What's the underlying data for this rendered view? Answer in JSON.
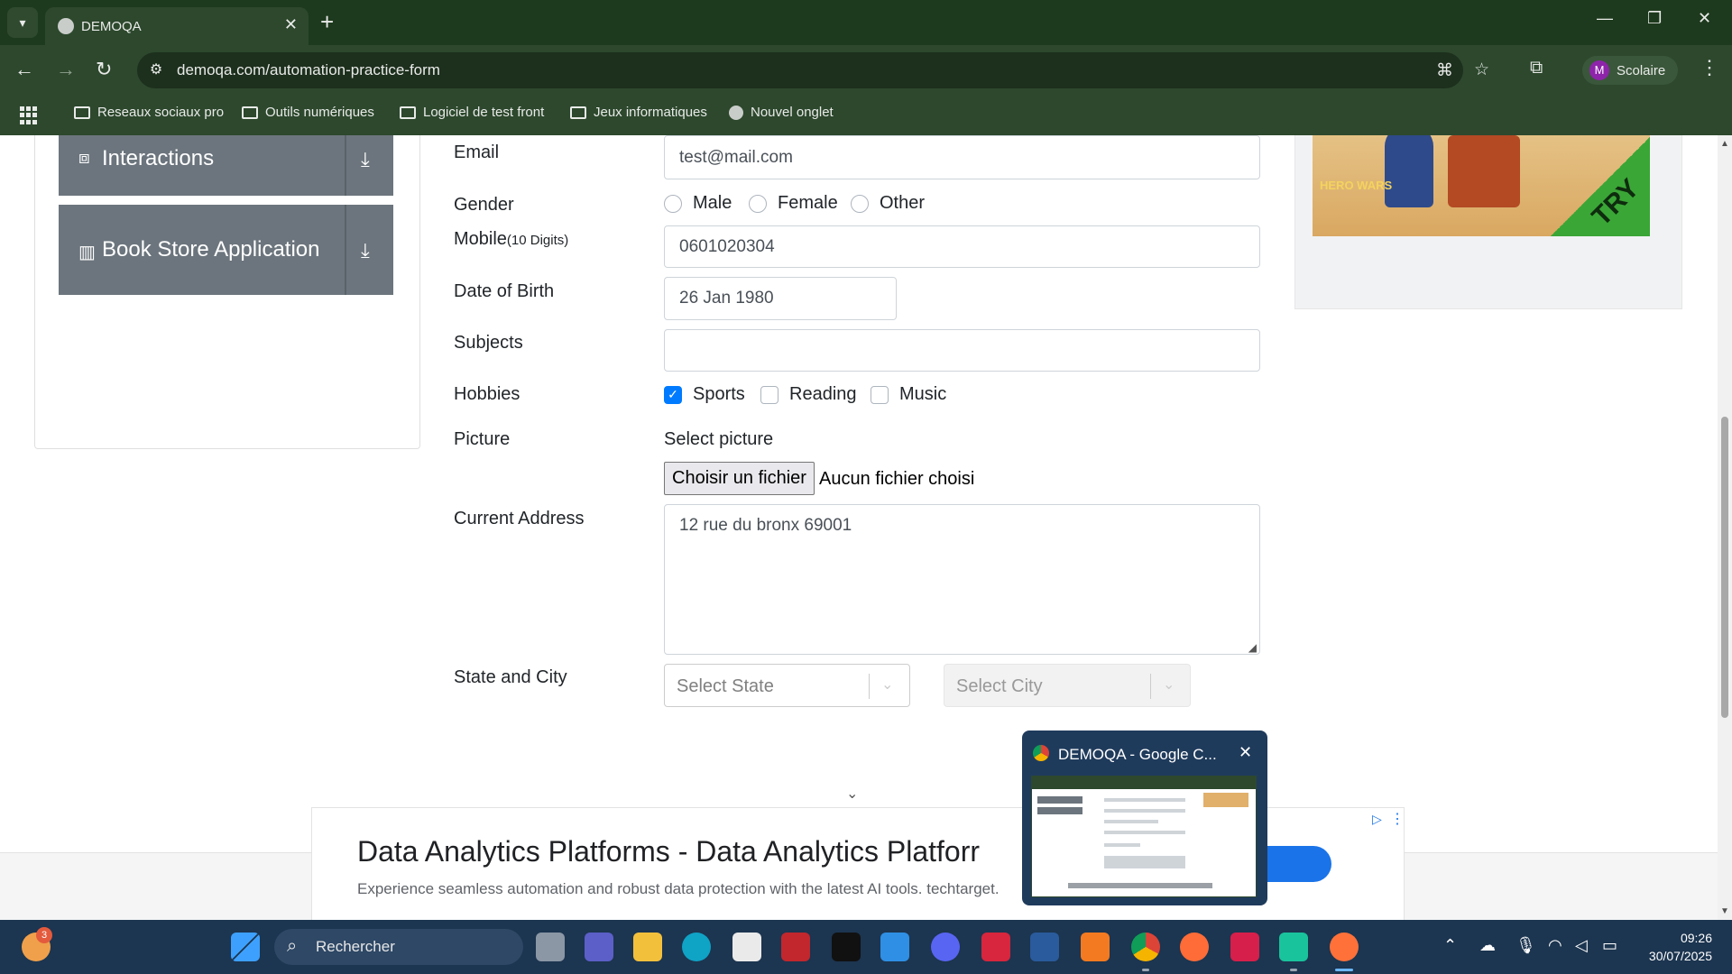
{
  "browser": {
    "tab_title": "DEMOQA",
    "url": "demoqa.com/automation-practice-form",
    "profile_initial": "M",
    "profile_name": "Scolaire",
    "bookmarks": [
      "Reseaux sociaux pro",
      "Outils numériques",
      "Logiciel de test front",
      "Jeux informatiques",
      "Nouvel onglet"
    ]
  },
  "sidebar": {
    "groups": [
      {
        "label": "Interactions",
        "icon": "interactions-icon"
      },
      {
        "label": "Book Store Application",
        "icon": "bookstore-icon"
      }
    ]
  },
  "form": {
    "email_label": "Email",
    "email_value": "test@mail.com",
    "gender_label": "Gender",
    "gender_options": [
      "Male",
      "Female",
      "Other"
    ],
    "mobile_label": "Mobile",
    "mobile_hint": "(10 Digits)",
    "mobile_value": "0601020304",
    "dob_label": "Date of Birth",
    "dob_value": "26 Jan 1980",
    "subjects_label": "Subjects",
    "subjects_value": "",
    "hobbies_label": "Hobbies",
    "hobbies": [
      {
        "label": "Sports",
        "checked": true
      },
      {
        "label": "Reading",
        "checked": false
      },
      {
        "label": "Music",
        "checked": false
      }
    ],
    "picture_label": "Picture",
    "picture_prompt": "Select picture",
    "file_button": "Choisir un fichier",
    "file_status": "Aucun fichier choisi",
    "address_label": "Current Address",
    "address_value": "12 rue du bronx 69001",
    "state_city_label": "State and City",
    "state_placeholder": "Select State",
    "city_placeholder": "Select City"
  },
  "ads": {
    "side_logo": "HERO WARS",
    "side_cta": "TRY",
    "bottom_headline": "Data Analytics Platforms - Data Analytics Platforr",
    "bottom_sub": "Experience seamless automation and robust data protection with the latest AI tools. techtarget."
  },
  "preview": {
    "title": "DEMOQA - Google C..."
  },
  "taskbar": {
    "search_placeholder": "Rechercher",
    "weather_badge": "3",
    "time": "09:26",
    "date": "30/07/2025"
  },
  "colors": {
    "chrome_frame": "#1e3a1e",
    "chrome_toolbar": "#2d482d",
    "sidebar_group": "#6c757d",
    "checkbox_accent": "#007bff",
    "taskbar": "#1c3550"
  }
}
